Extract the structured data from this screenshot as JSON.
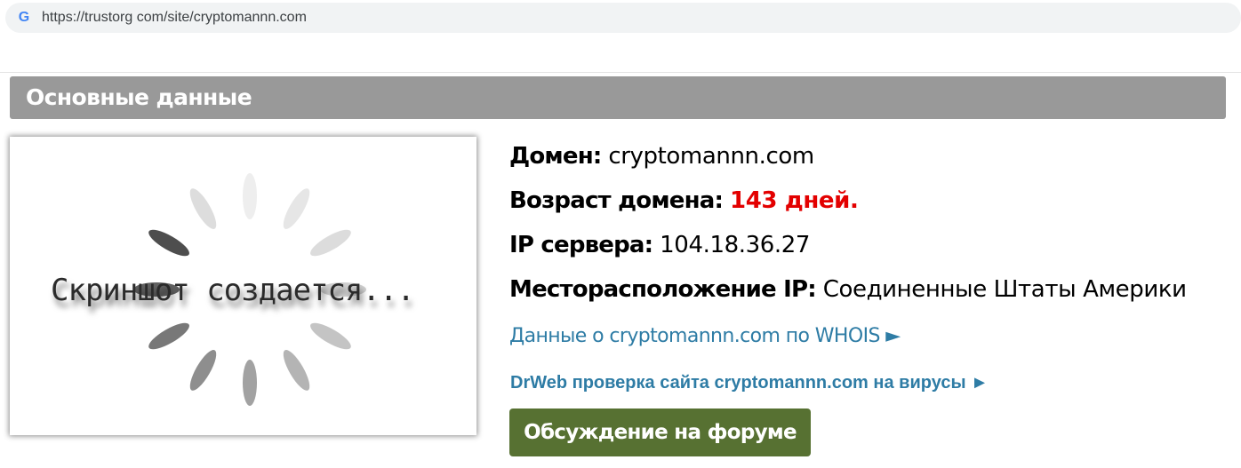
{
  "browser": {
    "favicon": "G",
    "url": "https://trustorg com/site/cryptomannn.com"
  },
  "section": {
    "title": "Основные данные"
  },
  "screenshot": {
    "caption": "Скриншот создается..."
  },
  "info": {
    "domain_label": "Домен:",
    "domain_value": "cryptomannn.com",
    "age_label": "Возраст домена:",
    "age_value": "143 дней.",
    "ip_label": "IP сервера:",
    "ip_value": "104.18.36.27",
    "location_label": "Месторасположение IP:",
    "location_value": "Соединенные Штаты Америки"
  },
  "links": {
    "whois": "Данные о cryptomannn.com по WHOIS ►",
    "drweb": "DrWeb проверка сайта cryptomannn.com на вирусы ►"
  },
  "forum_button": "Обсуждение на форуме",
  "colors": {
    "header_bg": "#999999",
    "link": "#2e7ca5",
    "age_red": "#e30000",
    "button_bg": "#577132"
  }
}
